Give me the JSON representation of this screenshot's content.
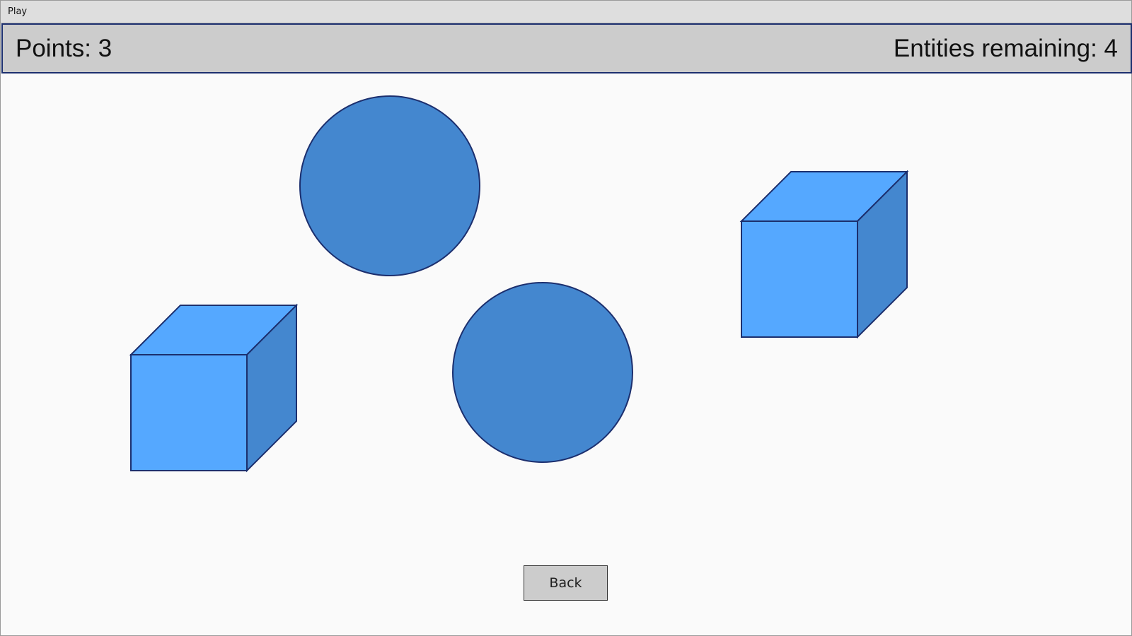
{
  "window": {
    "title": "Play"
  },
  "hud": {
    "points_label": "Points: 3",
    "entities_remaining_label": "Entities remaining: 4"
  },
  "entities": [
    {
      "kind": "circle"
    },
    {
      "kind": "cube"
    },
    {
      "kind": "circle"
    },
    {
      "kind": "cube"
    }
  ],
  "colors": {
    "circle_fill": "#4487cf",
    "cube_front": "#55a8ff",
    "cube_side": "#4487cf",
    "outline": "#1c2f6e",
    "hud_background": "#cccccc"
  },
  "buttons": {
    "back_label": "Back"
  }
}
